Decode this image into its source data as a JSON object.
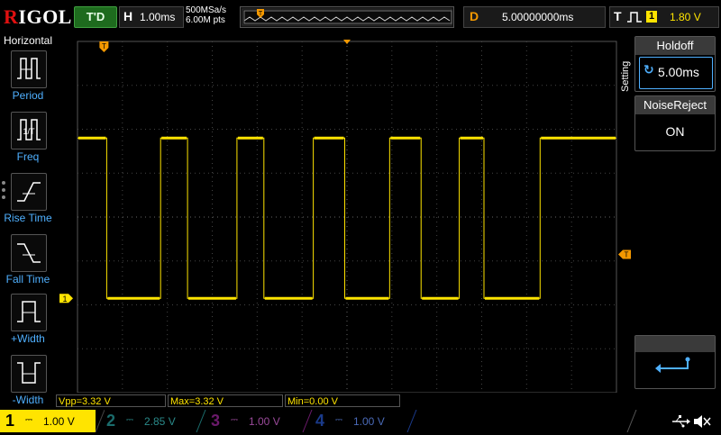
{
  "header": {
    "logo": "RIGOL",
    "run_state": "T'D",
    "timebase": {
      "key": "H",
      "value": "1.00ms"
    },
    "sample_rate": "500MSa/s",
    "memory_depth": "6.00M pts",
    "delay": {
      "key": "D",
      "value": "5.00000000ms"
    },
    "trigger": {
      "key": "T",
      "edge_icon": "pulse-trigger-icon",
      "source": "1",
      "level": "1.80 V"
    }
  },
  "left_menu": {
    "title": "Horizontal",
    "items": [
      {
        "label": "Period",
        "icon": "period-measure-icon"
      },
      {
        "label": "Freq",
        "icon": "frequency-measure-icon"
      },
      {
        "label": "Rise Time",
        "icon": "rise-time-icon"
      },
      {
        "label": "Fall Time",
        "icon": "fall-time-icon"
      },
      {
        "label": "+Width",
        "icon": "positive-width-icon"
      },
      {
        "label": "-Width",
        "icon": "negative-width-icon"
      }
    ]
  },
  "waveform": {
    "channel": "1",
    "trigger_position_marker": "T",
    "trigger_level_marker": "T",
    "transitions_div": [
      0.65,
      1.85,
      2.45,
      3.55,
      4.15,
      5.25,
      5.95,
      6.95,
      7.65,
      8.5,
      9.05,
      10.3
    ],
    "high_level_div": 2.2,
    "low_level_div": 5.85,
    "color": "#ffe400"
  },
  "right_panel": {
    "setting_label": "Setting",
    "holdoff": {
      "title": "Holdoff",
      "value": "5.00ms"
    },
    "noise_reject": {
      "title": "NoiseReject",
      "value": "ON"
    }
  },
  "measurements": [
    {
      "label": "Vpp=3.32 V"
    },
    {
      "label": "Max=3.32 V"
    },
    {
      "label": "Min=0.00 V"
    }
  ],
  "channels": [
    {
      "num": "1",
      "coupling": "⎓",
      "scale": "1.00 V"
    },
    {
      "num": "2",
      "coupling": "⎓",
      "scale": "2.85 V"
    },
    {
      "num": "3",
      "coupling": "⎓",
      "scale": "1.00 V"
    },
    {
      "num": "4",
      "coupling": "⎓",
      "scale": "1.00 V"
    }
  ],
  "colors": {
    "ch1": "#ffe400",
    "ch2": "#1a8a8a",
    "ch3": "#8a2a8a",
    "ch4": "#2a4aa8",
    "trigger": "#f39800",
    "accent": "#4fb0ff"
  }
}
